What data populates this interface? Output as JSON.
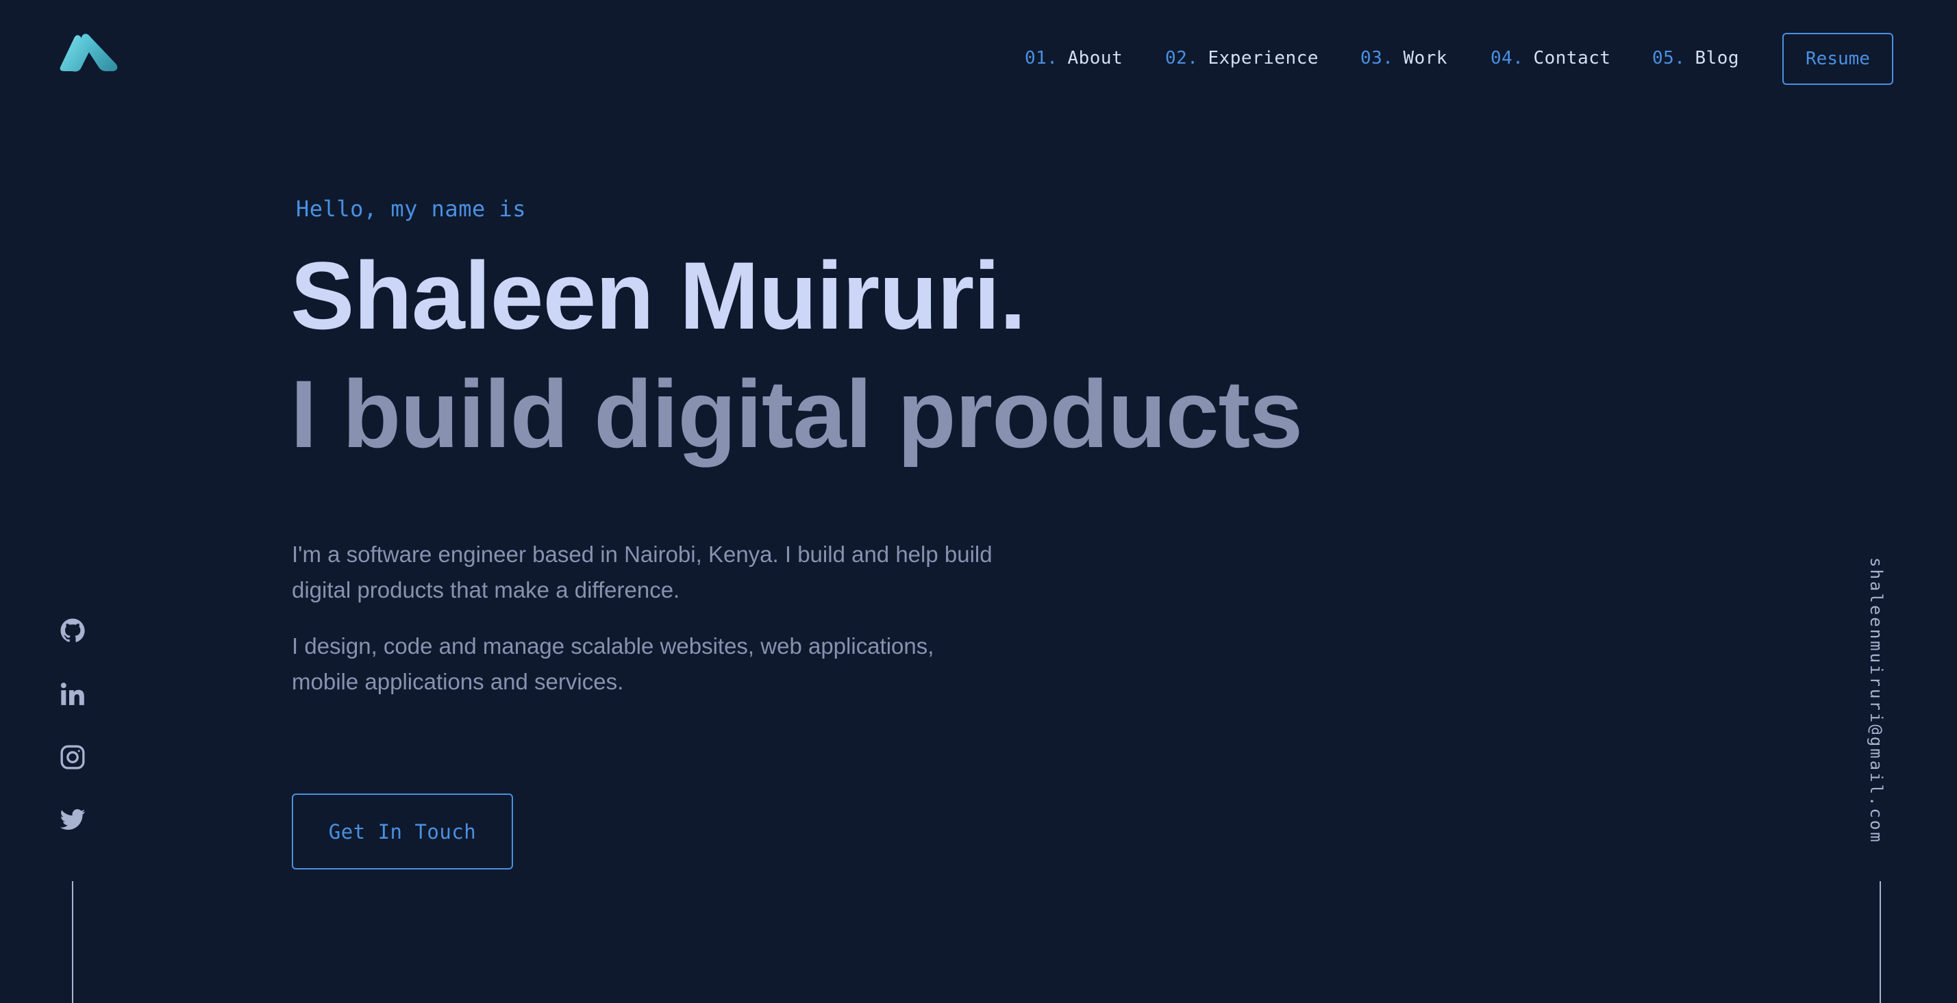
{
  "header": {
    "logo_icon": "brand-logo-icon",
    "nav": [
      {
        "num": "01.",
        "label": "About"
      },
      {
        "num": "02.",
        "label": "Experience"
      },
      {
        "num": "03.",
        "label": "Work"
      },
      {
        "num": "04.",
        "label": "Contact"
      },
      {
        "num": "05.",
        "label": "Blog"
      }
    ],
    "resume_label": "Resume"
  },
  "hero": {
    "greeting": "Hello, my name is",
    "name": "Shaleen Muiruri.",
    "tagline": "I build digital products",
    "paragraphs": [
      "I'm a software engineer based in Nairobi, Kenya. I build and help build digital products that make a difference.",
      "I design, code and manage scalable websites, web applications, mobile applications and services."
    ],
    "cta_label": "Get In Touch"
  },
  "social": {
    "icons": [
      "github-icon",
      "linkedin-icon",
      "instagram-icon",
      "twitter-icon"
    ]
  },
  "email": "shaleenmuiruri@gmail.com",
  "colors": {
    "background": "#0e192d",
    "accent": "#4a90e2",
    "heading": "#ccd6f6",
    "muted": "#8892b0",
    "logo_gradient": [
      "#64d6e8",
      "#3a9fb0"
    ]
  }
}
